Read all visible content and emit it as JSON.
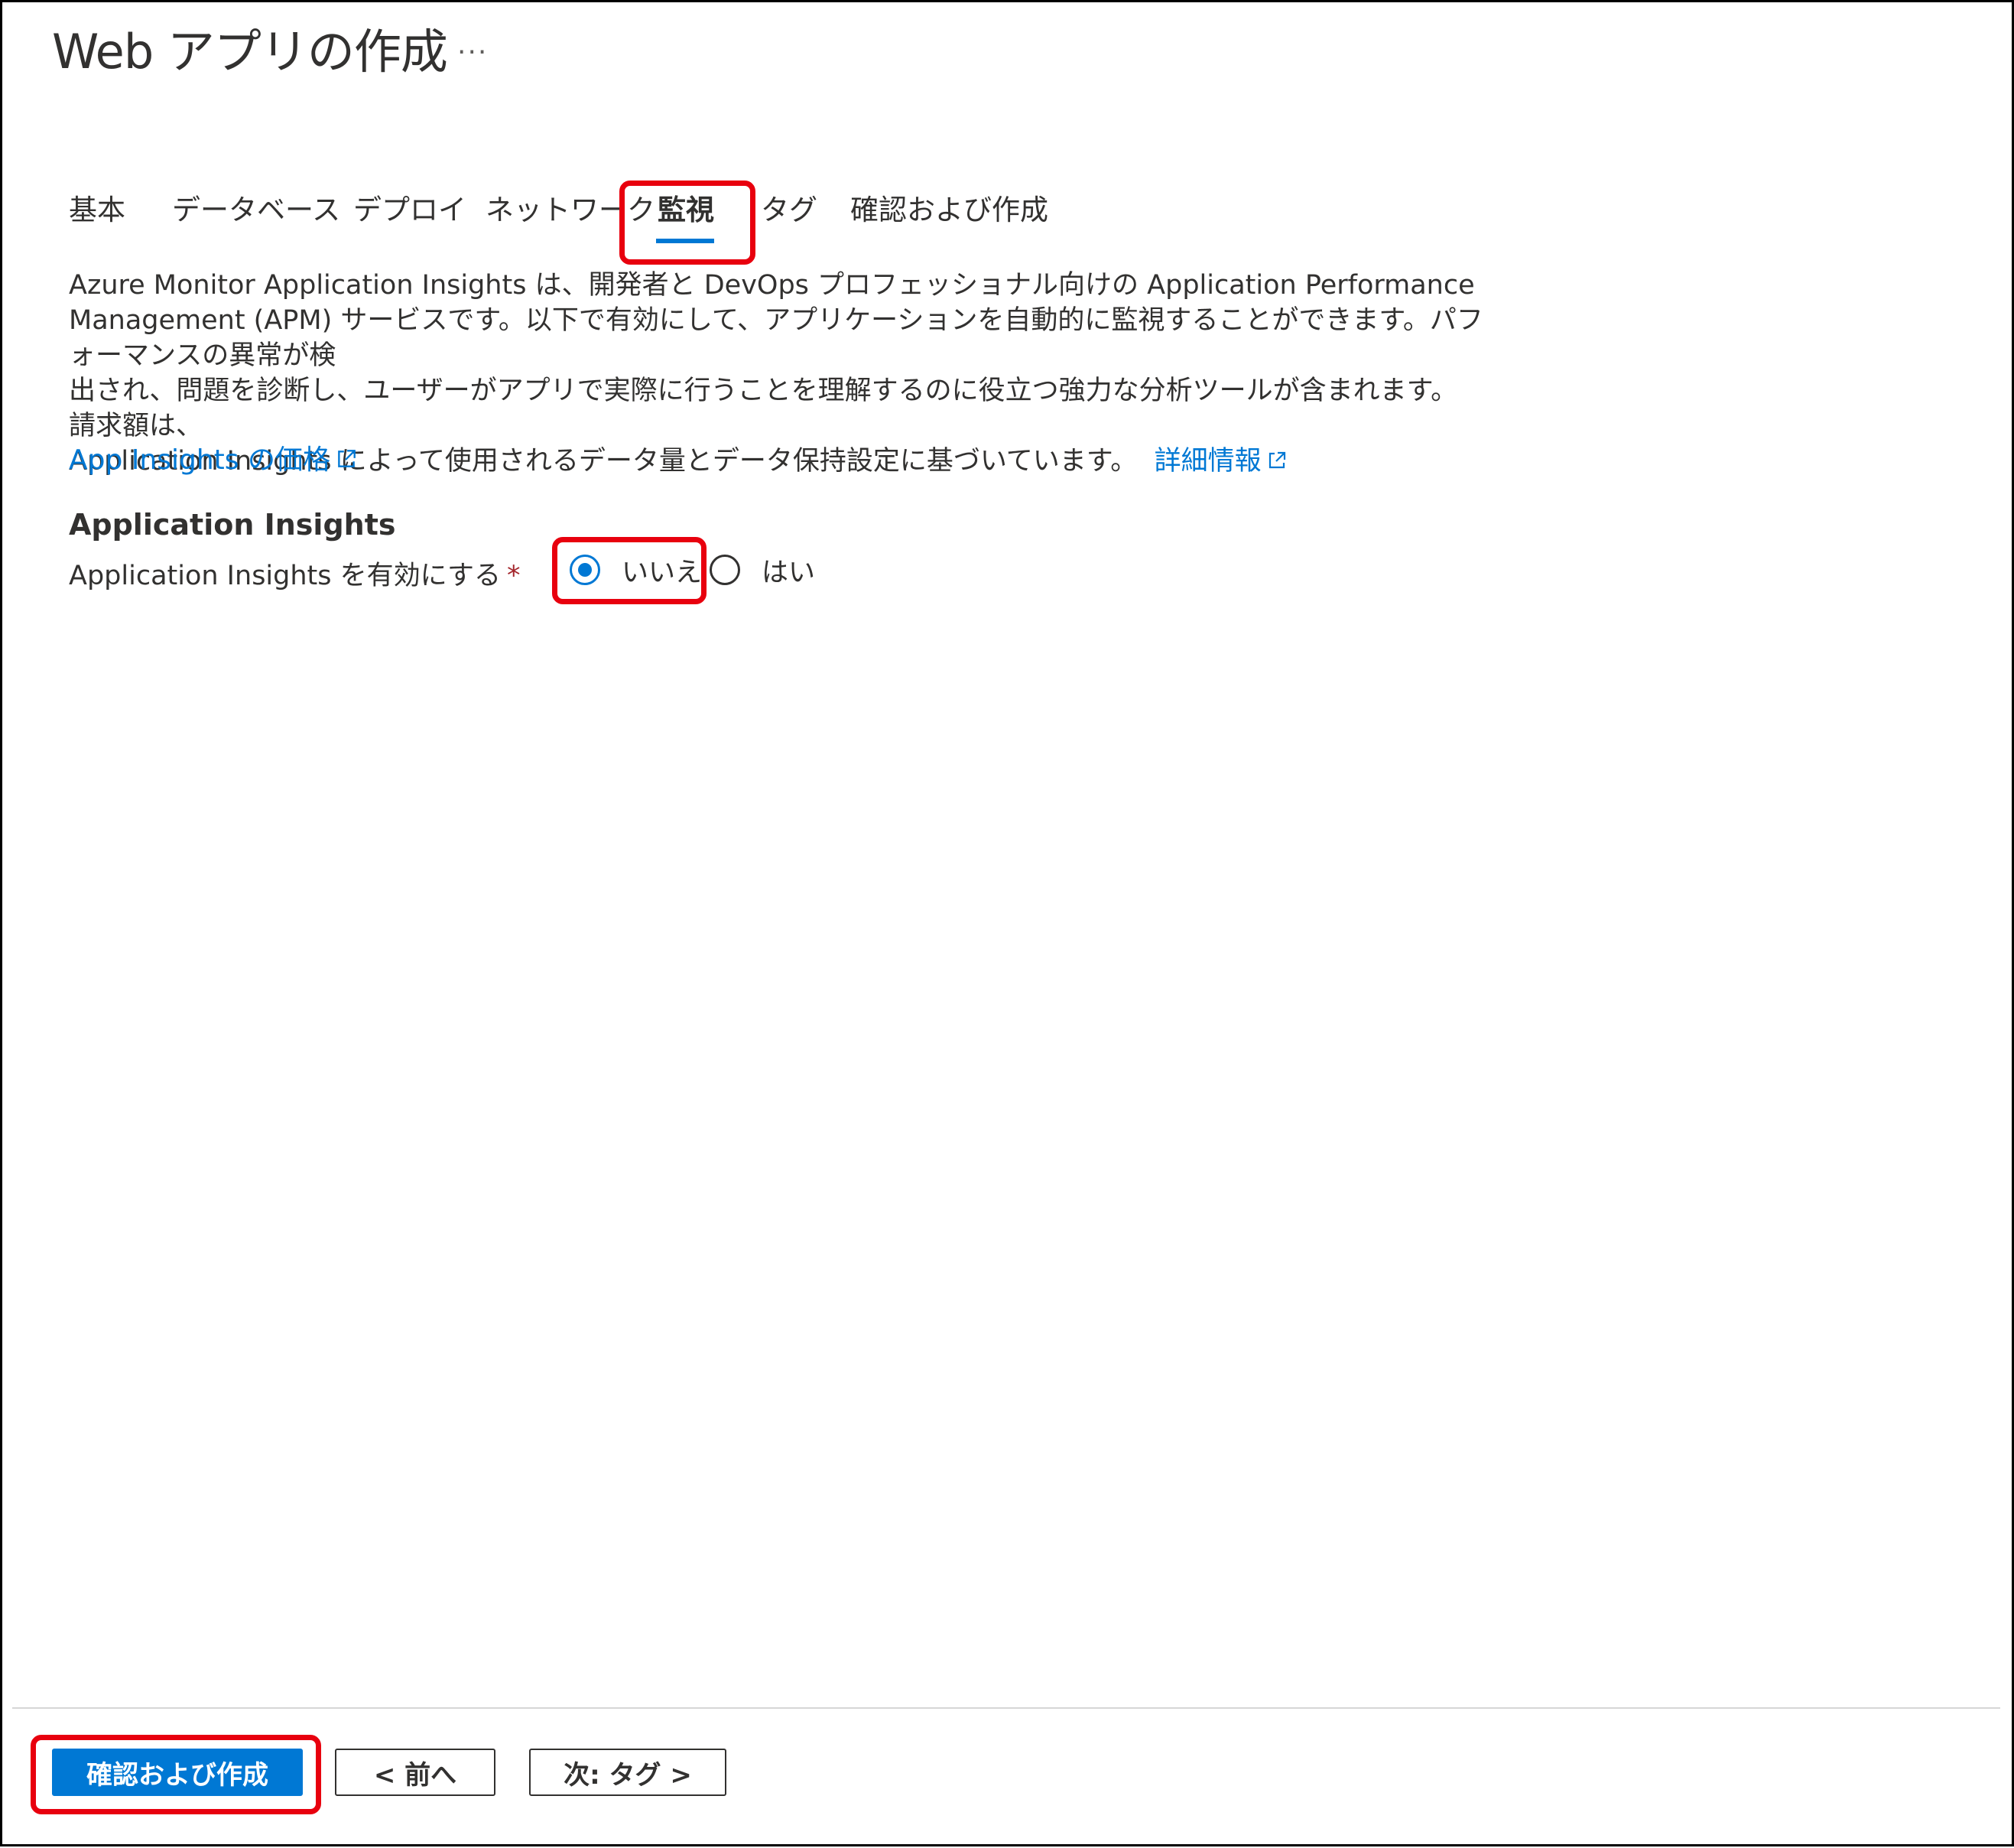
{
  "header": {
    "title": "Web アプリの作成",
    "more": "..."
  },
  "tabs": [
    {
      "label": "基本",
      "active": false
    },
    {
      "label": "データベース",
      "active": false
    },
    {
      "label": "デプロイ",
      "active": false
    },
    {
      "label": "ネットワーク",
      "active": false
    },
    {
      "label": "監視",
      "active": true
    },
    {
      "label": "タグ",
      "active": false
    },
    {
      "label": "確認および作成",
      "active": false
    }
  ],
  "description": {
    "line1": "Azure Monitor Application Insights は、開発者と DevOps プロフェッショナル向けの Application Performance",
    "line2": "Management (APM) サービスです。以下で有効にして、アプリケーションを自動的に監視することができます。パフォーマンスの異常が検",
    "line3": "出され、問題を診断し、ユーザーがアプリで実際に行うことを理解するのに役立つ強力な分析ツールが含まれます。請求額は、",
    "line4": "Application Insights によって使用されるデータ量とデータ保持設定に基づいています。",
    "more_link": "詳細情報"
  },
  "pricing_link": "App Insights の価格",
  "section": {
    "heading": "Application Insights",
    "field_label": "Application Insights を有効にする",
    "required_mark": "*",
    "options": [
      {
        "label": "いいえ",
        "selected": true
      },
      {
        "label": "はい",
        "selected": false
      }
    ]
  },
  "footer": {
    "review_create": "確認および作成",
    "previous": "< 前へ",
    "next": "次: タグ >"
  },
  "colors": {
    "accent": "#0078d4",
    "highlight": "#e8000e",
    "required": "#a4262c"
  }
}
